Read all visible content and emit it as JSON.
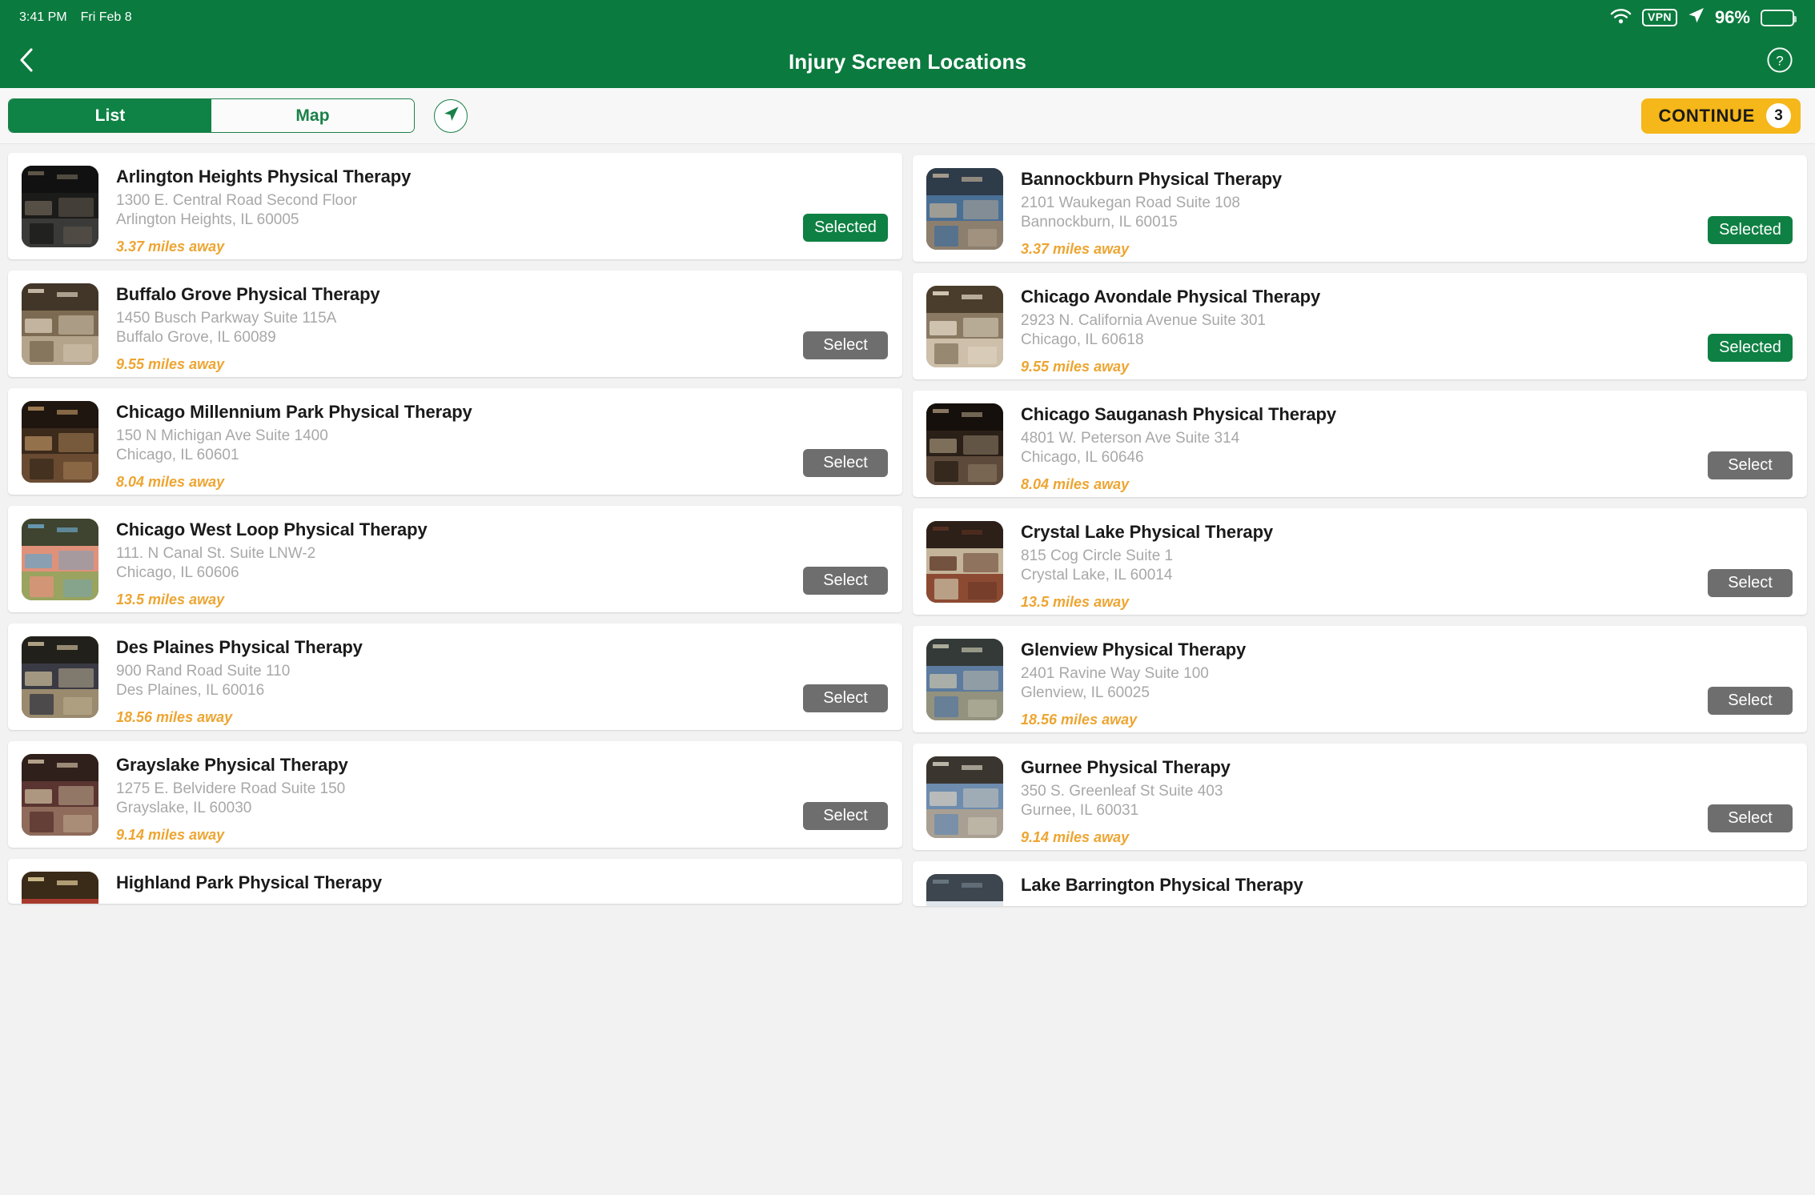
{
  "status_bar": {
    "time": "3:41 PM",
    "date": "Fri Feb 8",
    "wifi_icon": "wifi-icon",
    "vpn_label": "VPN",
    "location_icon": "location-arrow-icon",
    "battery_percent": "96%",
    "battery_icon": "battery-icon"
  },
  "header": {
    "back_icon": "chevron-left-icon",
    "title": "Injury Screen Locations",
    "help_icon": "question-mark-circle-icon",
    "accent_color": "#0b7a3e"
  },
  "toolbar": {
    "tabs": [
      {
        "label": "List",
        "active": true
      },
      {
        "label": "Map",
        "active": false
      }
    ],
    "locate_icon": "navigation-arrow-icon",
    "continue_label": "CONTINUE",
    "continue_count": "3",
    "continue_color": "#f5b719",
    "selected_color": "#0e8043",
    "select_color": "#6e6e6e",
    "distance_color": "#eda532"
  },
  "locations": [
    {
      "name": "Arlington Heights Physical Therapy",
      "address": "1300 E. Central Road Second Floor",
      "city_state_zip": "Arlington Heights, IL 60005",
      "distance": "3.37 miles away",
      "action": "Selected",
      "state": "selected",
      "thumb": "interior-clinic-dark-ceiling"
    },
    {
      "name": "Bannockburn Physical Therapy",
      "address": "2101 Waukegan Road Suite 108",
      "city_state_zip": "Bannockburn, IL 60015",
      "distance": "3.37 miles away",
      "action": "Selected",
      "state": "selected",
      "thumb": "interior-hallway-blue-tables"
    },
    {
      "name": "Buffalo Grove Physical Therapy",
      "address": "1450 Busch Parkway Suite 115A",
      "city_state_zip": "Buffalo Grove, IL 60089",
      "distance": "9.55 miles away",
      "action": "Select",
      "state": "select",
      "thumb": "interior-tan-walls-tables"
    },
    {
      "name": "Chicago Avondale Physical Therapy",
      "address": "2923 N. California Avenue Suite 301",
      "city_state_zip": "Chicago, IL 60618",
      "distance": "9.55 miles away",
      "action": "Selected",
      "state": "selected",
      "thumb": "interior-open-gym-windows"
    },
    {
      "name": "Chicago Millennium Park Physical Therapy",
      "address": "150 N Michigan Ave Suite 1400",
      "city_state_zip": "Chicago, IL 60601",
      "distance": "8.04 miles away",
      "action": "Select",
      "state": "select",
      "thumb": "interior-warm-lit-gym"
    },
    {
      "name": "Chicago Sauganash Physical Therapy",
      "address": "4801 W. Peterson Ave Suite 314",
      "city_state_zip": "Chicago, IL 60646",
      "distance": "8.04 miles away",
      "action": "Select",
      "state": "select",
      "thumb": "interior-dark-window-gym"
    },
    {
      "name": "Chicago West Loop Physical Therapy",
      "address": "111. N Canal St. Suite LNW-2",
      "city_state_zip": "Chicago, IL 60606",
      "distance": "13.5 miles away",
      "action": "Select",
      "state": "select",
      "thumb": "interior-colorful-treatment-tables"
    },
    {
      "name": "Crystal Lake Physical Therapy",
      "address": "815 Cog Circle Suite 1",
      "city_state_zip": "Crystal Lake, IL 60014",
      "distance": "13.5 miles away",
      "action": "Select",
      "state": "select",
      "thumb": "exterior-brick-storefront"
    },
    {
      "name": "Des Plaines Physical Therapy",
      "address": "900 Rand Road Suite 110",
      "city_state_zip": "Des Plaines, IL 60016",
      "distance": "18.56 miles away",
      "action": "Select",
      "state": "select",
      "thumb": "interior-gym-treadmills"
    },
    {
      "name": "Glenview Physical Therapy",
      "address": "2401 Ravine Way Suite 100",
      "city_state_zip": "Glenview, IL 60025",
      "distance": "18.56 miles away",
      "action": "Select",
      "state": "select",
      "thumb": "interior-hallway-blue-beds"
    },
    {
      "name": "Grayslake Physical Therapy",
      "address": "1275 E. Belvidere Road Suite 150",
      "city_state_zip": "Grayslake, IL 60030",
      "distance": "9.14 miles away",
      "action": "Select",
      "state": "select",
      "thumb": "interior-maroon-tables-windows"
    },
    {
      "name": "Gurnee Physical Therapy",
      "address": "350 S. Greenleaf St Suite 403",
      "city_state_zip": "Gurnee, IL 60031",
      "distance": "9.14 miles away",
      "action": "Select",
      "state": "select",
      "thumb": "interior-mirror-blue-tables"
    }
  ],
  "partial_locations": [
    {
      "name": "Highland Park Physical Therapy",
      "thumb": "interior-gold-red-wall"
    },
    {
      "name": "Lake Barrington Physical Therapy",
      "thumb": "interior-bright-windows"
    }
  ]
}
